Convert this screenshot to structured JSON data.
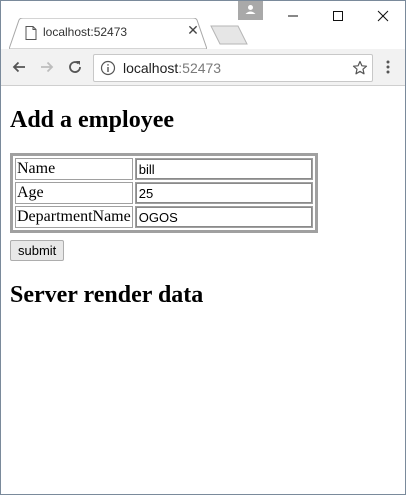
{
  "browser": {
    "tab_title": "localhost:52473",
    "url_host": "localhost",
    "url_port": ":52473",
    "accent": "#7a8a9b"
  },
  "page": {
    "heading": "Add a employee",
    "fields": [
      {
        "label": "Name",
        "value": "bill"
      },
      {
        "label": "Age",
        "value": "25"
      },
      {
        "label": "DepartmentName",
        "value": "OGOS"
      }
    ],
    "submit_label": "submit",
    "server_heading": "Server render data"
  }
}
